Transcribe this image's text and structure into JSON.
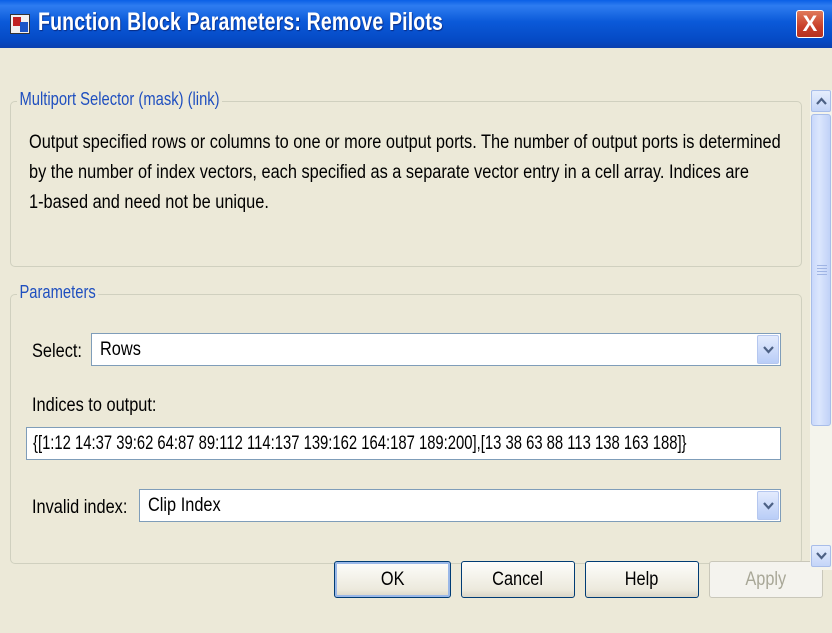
{
  "window": {
    "title": "Function Block Parameters: Remove Pilots",
    "close_label": "X"
  },
  "mask": {
    "legend": "Multiport Selector (mask) (link)",
    "description": [
      "Output specified rows or columns to one or more output ports.  The number of output ports is determined",
      "by the number of index vectors, each specified as a separate vector entry in a cell array.  Indices are",
      "1-based and need not be unique."
    ]
  },
  "parameters": {
    "legend": "Parameters",
    "select_label": "Select:",
    "select_value": "Rows",
    "indices_label": "Indices to output:",
    "indices_value": "{[1:12 14:37 39:62 64:87 89:112 114:137 139:162 164:187 189:200],[13 38 63 88 113 138 163 188]}",
    "invalid_index_label": "Invalid index:",
    "invalid_index_value": "Clip Index"
  },
  "buttons": {
    "ok": "OK",
    "cancel": "Cancel",
    "help": "Help",
    "apply": "Apply"
  },
  "colors": {
    "titlebar": "#0a5fe6",
    "legend_text": "#1f4fbf",
    "dialog_bg": "#ece9d8",
    "close_button": "#c9402a"
  }
}
